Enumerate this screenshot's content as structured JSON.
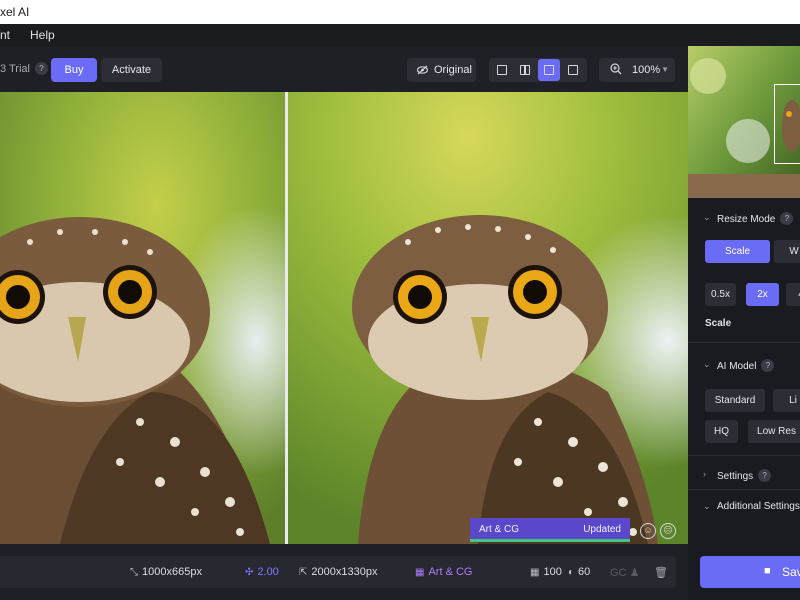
{
  "app": {
    "title": "xel AI"
  },
  "menu": {
    "items": [
      "nt",
      "Help"
    ]
  },
  "toolbar": {
    "trial_text": "3 Trial",
    "trial_help": "?",
    "buy_label": "Buy",
    "activate_label": "Activate",
    "original_label": "Original",
    "zoom_value": "100%"
  },
  "canvas": {
    "badge_model": "Art & CG",
    "badge_status": "Updated"
  },
  "status": {
    "source_size": "1000x665px",
    "scale": "2.00",
    "output_size": "2000x1330px",
    "model": "Art & CG",
    "value_a": "100",
    "value_b": "60",
    "gc_label": "GC"
  },
  "panel": {
    "resize_mode_label": "Resize Mode",
    "resize_help": "?",
    "mode_scale": "Scale",
    "mode_w": "W",
    "scale_options": [
      "0.5x",
      "2x",
      "4"
    ],
    "scale_label": "Scale",
    "ai_model_label": "AI Model",
    "ai_help": "?",
    "models": [
      "Standard",
      "Li",
      "HQ",
      "Low Res"
    ],
    "settings_label": "Settings",
    "settings_help": "?",
    "additional_label": "Additional Settings",
    "save_label": "Sav"
  },
  "colors": {
    "accent": "#6b6cf6",
    "badge": "#5b47c9",
    "progress": "#3ec97f"
  }
}
